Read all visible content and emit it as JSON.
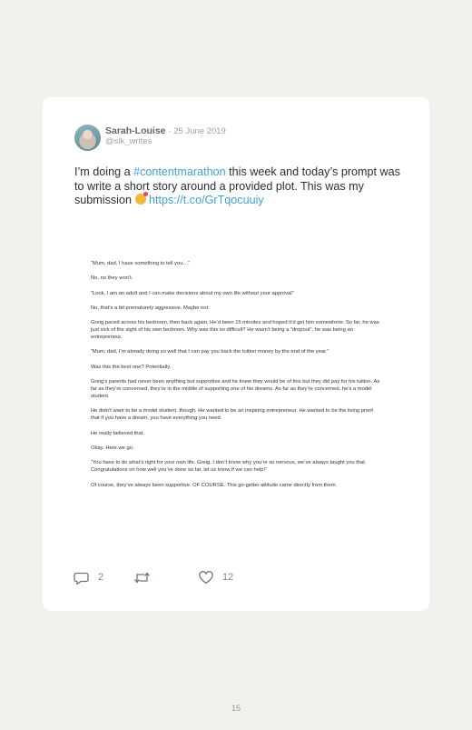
{
  "tweet": {
    "author_name": "Sarah-Louise",
    "date": "· 25 June 2019",
    "handle": "@slk_writes",
    "text_part1": "I’m doing a ",
    "hashtag": "#contentmarathon",
    "text_part2": " this week and today’s prompt was to write a short story around a provided plot. This was my submission ",
    "link": "https://t.co/GrTqocuuiy",
    "story_paragraphs": [
      "“Mum, dad, I have something to tell you…”",
      "No, no they won’t.",
      "“Look, I am an adult and I can make decisions about my own life without your approval”",
      "No, that’s a bit prematurely aggressive. Maybe not.",
      "Greig paced across his bedroom, then back again. He’d been 15 minutes and hoped it’d get him somewhere. So far, he was just sick of the sight of his own bedroom. Why was this so difficult? He wasn’t being a “dropout”, he was being an entrepreneur.",
      "“Mum, dad, I’m already doing so well that I can pay you back the tuition money by the end of the year.”",
      "Was this the best one? Potentially.",
      "Greig’s parents had never been anything but supportive and he knew they would be of this but they did pay for his tuition. As far as they’re concerned, they’re in the middle of supporting one of his dreams. As far as they’re concerned, he’s a model student.",
      "He didn’t want to be a model student, though. He wanted to be an inspiring entrepreneur. He wanted to be the living proof that if you have a dream, you have everything you need.",
      "He really believed that.",
      "Okay. Here we go.",
      "“You have to do what’s right for your own life, Greig. I don’t know why you’re so nervous, we’ve always taught you that. Congratulations on how well you’ve done so far, let us know if we can help!”",
      "Of course, they’ve always been supportive. OF COURSE. This go-getter attitude came directly from them."
    ],
    "replies_count": "2",
    "likes_count": "12"
  },
  "icons": {
    "reply": "reply-icon",
    "retweet": "retweet-icon",
    "like": "heart-icon",
    "emoji": "heart-face-emoji"
  },
  "page_number": "15"
}
